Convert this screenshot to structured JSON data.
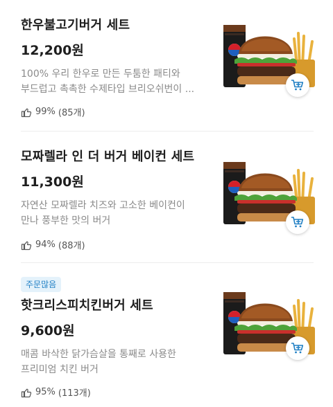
{
  "currency": "원",
  "items": [
    {
      "name": "한우불고기버거 세트",
      "price": "12,200원",
      "desc_line1": "100% 우리 한우로 만든 두툼한 패티와",
      "desc_line2": "부드럽고 촉촉한 수제타입 브리오쉬번이 ...",
      "rating": "99%",
      "review_count": "(85개)",
      "badge": null,
      "image_icon": "burger-set-photo",
      "cart_icon": "cart-plus-icon"
    },
    {
      "name": "모짜렐라 인 더 버거 베이컨 세트",
      "price": "11,300원",
      "desc_line1": "자연산 모짜렐라 치즈와 고소한 베이컨이",
      "desc_line2": "만나 풍부한 맛의 버거",
      "rating": "94%",
      "review_count": "(88개)",
      "badge": null,
      "image_icon": "burger-set-photo",
      "cart_icon": "cart-plus-icon"
    },
    {
      "name": "핫크리스피치킨버거 세트",
      "price": "9,600원",
      "desc_line1": "매콤 바삭한 닭가슴살을 통째로 사용한",
      "desc_line2": "프리미엄 치킨 버거",
      "rating": "95%",
      "review_count": "(113개)",
      "badge": "주문많음",
      "image_icon": "burger-set-photo",
      "cart_icon": "cart-plus-icon"
    }
  ],
  "colors": {
    "accent": "#1f7fc4",
    "badge_bg": "#e4f2fb",
    "text_primary": "#1e1e1e",
    "text_secondary": "#8a8a8a"
  },
  "drink_label": "PEPSI"
}
